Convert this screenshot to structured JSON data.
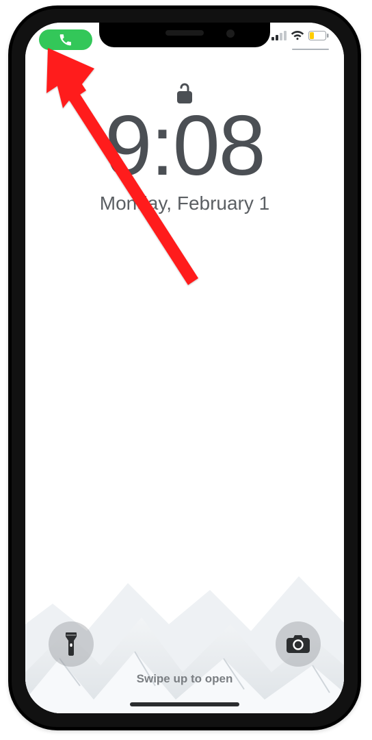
{
  "status": {
    "call_pill_icon": "phone-icon",
    "call_pill_color": "#33c759",
    "signal_bars": 2,
    "battery_level_color": "#ffcc00"
  },
  "lock": {
    "icon": "unlocked-icon"
  },
  "clock": {
    "time": "9:08",
    "date": "Monday, February 1"
  },
  "quick_actions": {
    "flashlight_icon": "flashlight-icon",
    "camera_icon": "camera-icon"
  },
  "hint": {
    "swipe_label": "Swipe up to open"
  },
  "annotation": {
    "color": "#ff1e1e",
    "points_to": "call-pill"
  }
}
